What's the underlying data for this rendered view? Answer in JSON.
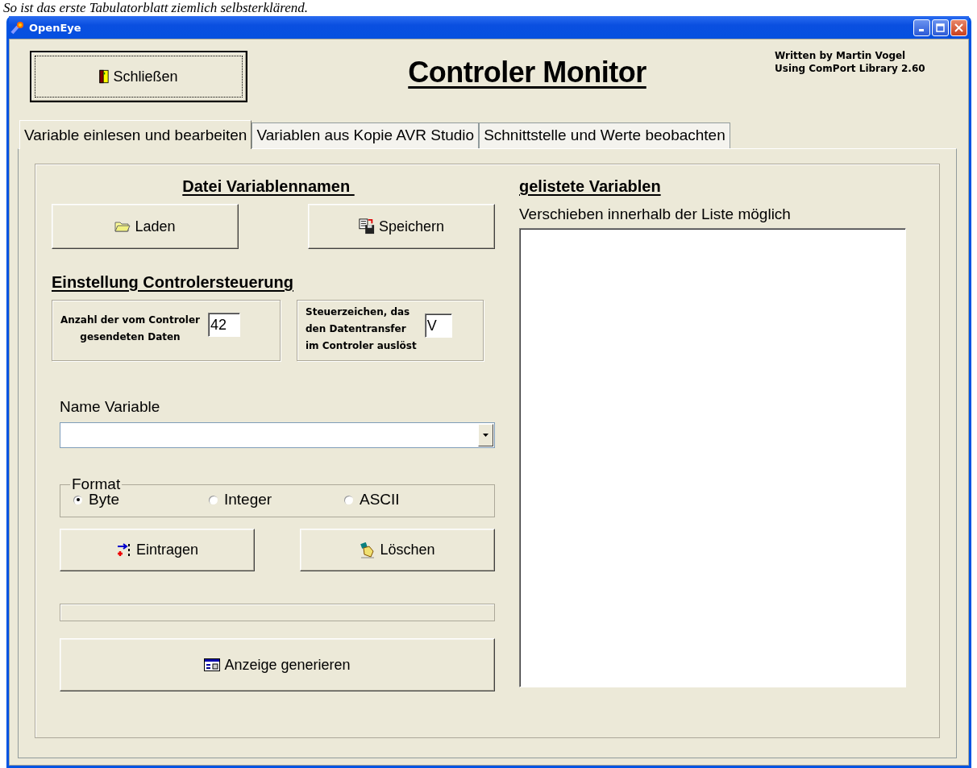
{
  "caption": "So ist das erste Tabulatorblatt ziemlich selbsterklärend.",
  "window": {
    "title": "OpenEye"
  },
  "header": {
    "close_button": {
      "label": "Schließen",
      "kind": "door"
    },
    "title": "Controler Monitor",
    "credits": [
      "Written by Martin Vogel",
      "Using ComPort Library 2.60"
    ]
  },
  "tabs": [
    {
      "label": "Variable einlesen und bearbeiten",
      "selected": true
    },
    {
      "label": "Variablen aus Kopie AVR Studio",
      "selected": false
    },
    {
      "label": "Schnittstelle und Werte beobachten",
      "selected": false
    }
  ],
  "file_section": {
    "heading": "Datei Variablennamen",
    "buttons": [
      {
        "label": "Laden",
        "kind": "folder"
      },
      {
        "label": "Speichern",
        "kind": "save"
      }
    ]
  },
  "settings_section": {
    "heading": "Einstellung Controlersteuerung",
    "fields": [
      {
        "lines": [
          "Anzahl der vom Controler",
          "gesendeten Daten"
        ],
        "value": "42"
      },
      {
        "lines": [
          "Steuerzeichen, das",
          "den Datentransfer",
          "im Controler auslöst"
        ],
        "value": "V"
      }
    ]
  },
  "variable": {
    "label": "Name Variable"
  },
  "format": {
    "legend": "Format",
    "options": [
      {
        "label": "Byte",
        "selected": true
      },
      {
        "label": "Integer",
        "selected": false
      },
      {
        "label": "ASCII",
        "selected": false
      }
    ]
  },
  "entry_buttons": [
    {
      "label": "Eintragen",
      "kind": "insert"
    },
    {
      "label": "Löschen",
      "kind": "erase"
    }
  ],
  "progress": {
    "level": 0
  },
  "generate_button": {
    "label": "Anzeige generieren",
    "kind": "display"
  },
  "list_section": {
    "heading": "gelistete Variablen",
    "hint": "Verschieben innerhalb der Liste möglich"
  }
}
